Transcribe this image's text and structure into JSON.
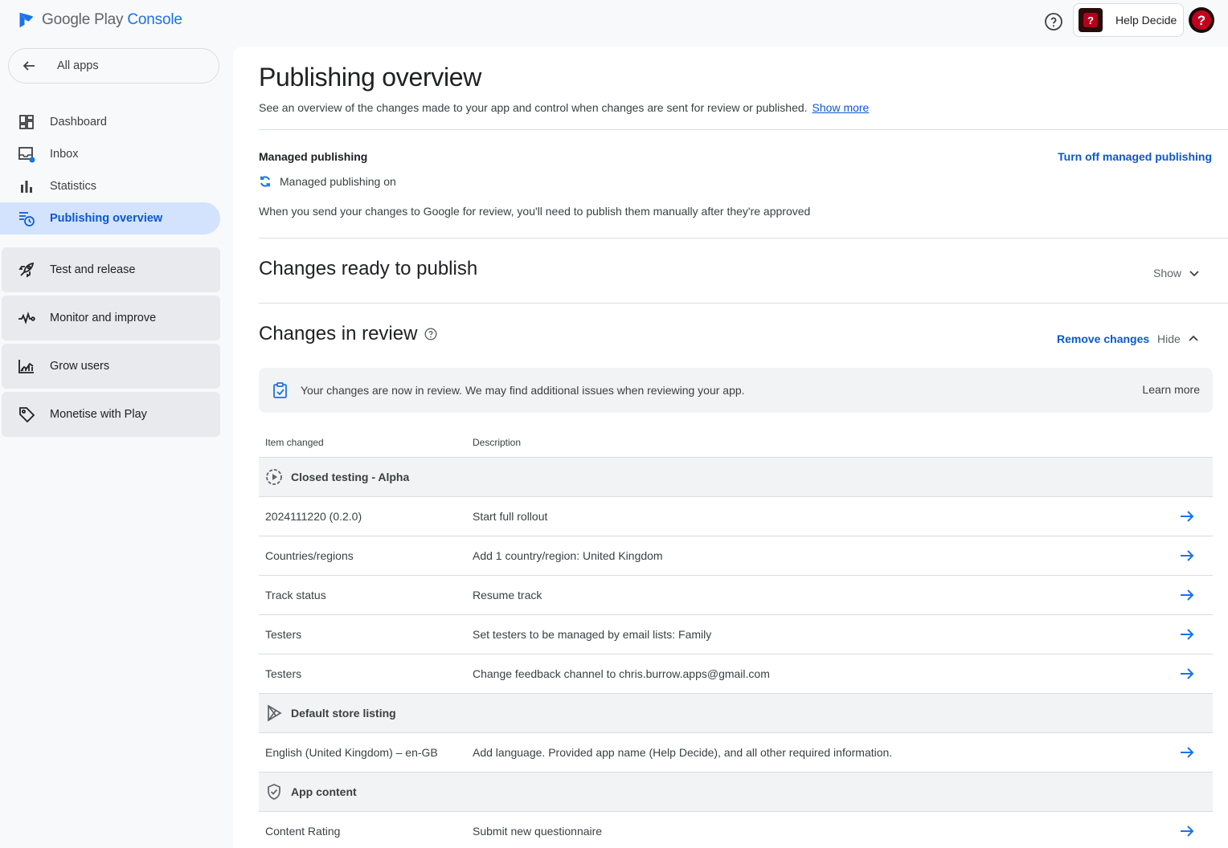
{
  "brand": {
    "name_part1": "Google Play",
    "name_part2": "Console",
    "accent": "#1a73e8"
  },
  "topbar": {
    "app_name": "Help Decide"
  },
  "sidebar": {
    "back_label": "All apps",
    "items": [
      {
        "label": "Dashboard",
        "icon": "dashboard-icon"
      },
      {
        "label": "Inbox",
        "icon": "inbox-icon"
      },
      {
        "label": "Statistics",
        "icon": "statistics-icon"
      },
      {
        "label": "Publishing overview",
        "icon": "publishing-icon",
        "active": true
      }
    ],
    "groups": [
      {
        "label": "Test and release",
        "icon": "rocket-icon"
      },
      {
        "label": "Monitor and improve",
        "icon": "vitals-icon"
      },
      {
        "label": "Grow users",
        "icon": "grow-icon"
      },
      {
        "label": "Monetise with Play",
        "icon": "tag-icon"
      }
    ]
  },
  "main": {
    "title": "Publishing overview",
    "description": "See an overview of the changes made to your app and control when changes are sent for review or published.",
    "show_more": "Show more",
    "managed": {
      "heading": "Managed publishing",
      "turn_off": "Turn off managed publishing",
      "status": "Managed publishing on",
      "note": "When you send your changes to Google for review, you'll need to publish them manually after they're approved"
    },
    "ready": {
      "heading": "Changes ready to publish",
      "toggle": "Show"
    },
    "review": {
      "heading": "Changes in review",
      "remove": "Remove changes",
      "toggle": "Hide",
      "banner": "Your changes are now in review. We may find additional issues when reviewing your app.",
      "learn_more": "Learn more",
      "col_item": "Item changed",
      "col_desc": "Description",
      "groups": [
        {
          "title": "Closed testing - Alpha",
          "icon": "closed-testing-icon",
          "rows": [
            {
              "item": "2024111220 (0.2.0)",
              "desc": "Start full rollout"
            },
            {
              "item": "Countries/regions",
              "desc": "Add 1 country/region: United Kingdom"
            },
            {
              "item": "Track status",
              "desc": "Resume track"
            },
            {
              "item": "Testers",
              "desc": "Set testers to be managed by email lists: Family"
            },
            {
              "item": "Testers",
              "desc": "Change feedback channel to chris.burrow.apps@gmail.com"
            }
          ]
        },
        {
          "title": "Default store listing",
          "icon": "play-store-icon",
          "rows": [
            {
              "item": "English (United Kingdom) – en-GB",
              "desc": "Add language. Provided app name (Help Decide), and all other required information."
            }
          ]
        },
        {
          "title": "App content",
          "icon": "shield-icon",
          "rows": [
            {
              "item": "Content Rating",
              "desc": "Submit new questionnaire"
            }
          ]
        }
      ]
    }
  }
}
